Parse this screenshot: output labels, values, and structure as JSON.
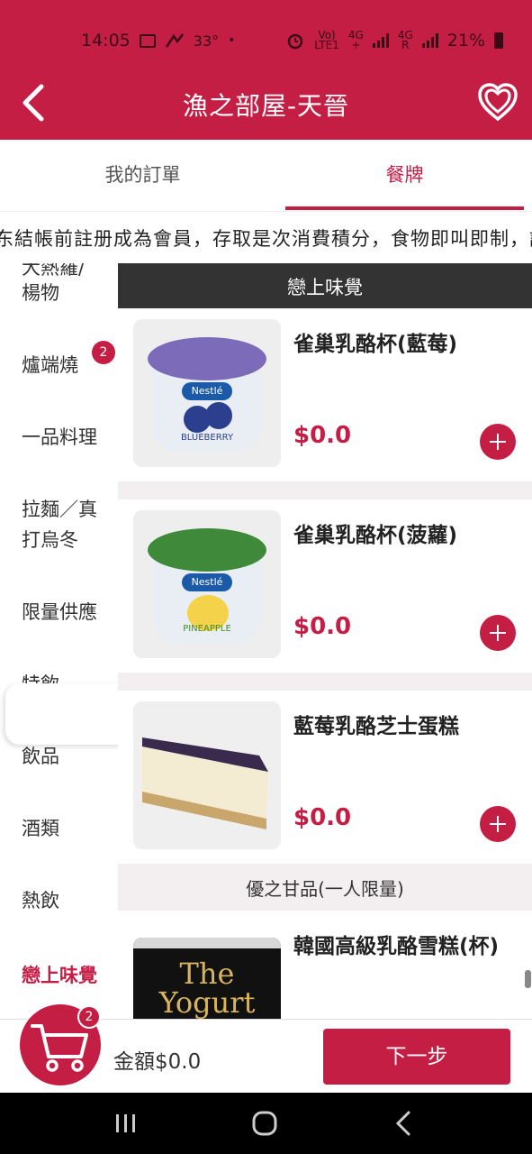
{
  "status_bar": {
    "time": "14:05",
    "temperature": "33°",
    "carrier_top": "Vo)",
    "carrier_bottom": "LTE1",
    "net1_top": "4G",
    "net1_bottom": "+",
    "net2_top": "4G",
    "net2_bottom": "R",
    "battery": "21%"
  },
  "header": {
    "title": "漁之部屋-天晉"
  },
  "tabs": {
    "orders": "我的訂單",
    "menu": "餐牌",
    "active": "menu"
  },
  "marquee": {
    "text": "东結帳前註册成為會員，存取是次消費積分，食物即叫即制，請"
  },
  "sidebar": {
    "partial_top": "大熱羅/",
    "items": [
      {
        "label": "楊物"
      },
      {
        "label": "爐端燒",
        "badge": "2"
      },
      {
        "label": "一品料理"
      },
      {
        "label": "拉麵／真\n打烏冬"
      },
      {
        "label": "限量供應"
      },
      {
        "label": "特飲"
      },
      {
        "label": "飲品"
      },
      {
        "label": "酒類"
      },
      {
        "label": "熱飲"
      }
    ],
    "active_label": "戀上味覺"
  },
  "menu": {
    "section1_title": "戀上味覺",
    "section2_title": "優之甘品(一人限量)",
    "items": [
      {
        "name": "雀巢乳酪杯(藍莓)",
        "price": "$0.0",
        "image_logo": "Nestlé",
        "image_flavor": "BLUEBERRY"
      },
      {
        "name": "雀巢乳酪杯(菠蘿)",
        "price": "$0.0",
        "image_logo": "Nestlé",
        "image_flavor": "PINEAPPLE"
      },
      {
        "name": "藍莓乳酪芝士蛋糕",
        "price": "$0.0"
      },
      {
        "name": "韓國高級乳酪雪糕(杯)",
        "image_text_1": "The",
        "image_text_2": "Yogurt"
      }
    ]
  },
  "cart": {
    "count": "2",
    "total": "金額$0.0",
    "next_label": "下一步"
  },
  "colors": {
    "brand": "#c41e45",
    "section_header": "#333333",
    "background_gray": "#f3eef0"
  }
}
